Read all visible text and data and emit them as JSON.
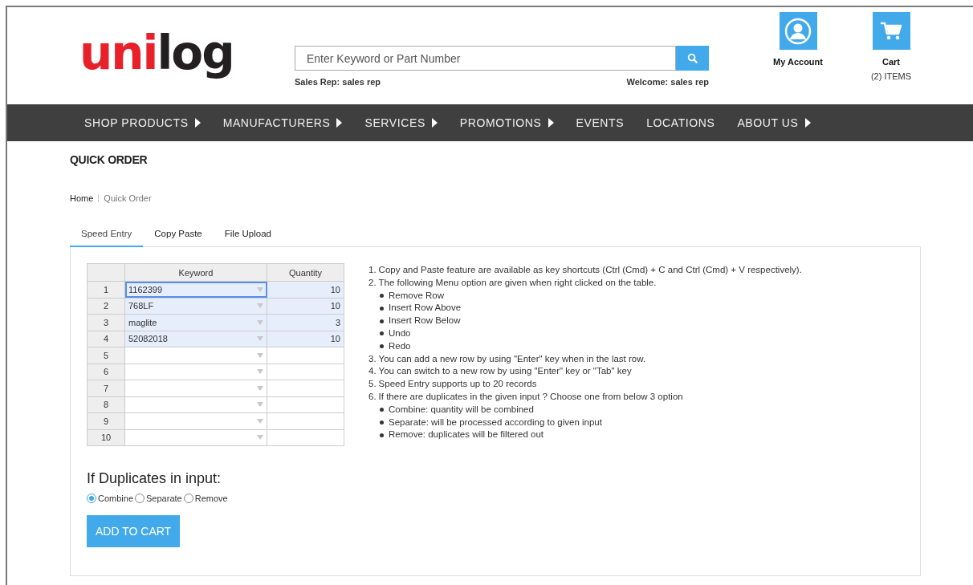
{
  "header": {
    "logo": {
      "red": "uni",
      "dark": "log"
    },
    "search": {
      "placeholder": "Enter Keyword or Part Number"
    },
    "sales_rep": "Sales Rep: sales rep",
    "welcome": "Welcome: sales rep",
    "account": {
      "label": "My Account"
    },
    "cart": {
      "label": "Cart",
      "count": "(2) ITEMS"
    }
  },
  "nav": [
    {
      "label": "SHOP PRODUCTS",
      "has_submenu": true
    },
    {
      "label": "MANUFACTURERS",
      "has_submenu": true
    },
    {
      "label": "SERVICES",
      "has_submenu": true
    },
    {
      "label": "PROMOTIONS",
      "has_submenu": true
    },
    {
      "label": "EVENTS",
      "has_submenu": false
    },
    {
      "label": "LOCATIONS",
      "has_submenu": false
    },
    {
      "label": "ABOUT US",
      "has_submenu": true
    }
  ],
  "page_title": "QUICK ORDER",
  "breadcrumb": [
    {
      "label": "Home",
      "current": false
    },
    {
      "label": "Quick Order",
      "current": true
    }
  ],
  "tabs": [
    {
      "label": "Speed Entry",
      "selected": true
    },
    {
      "label": "Copy Paste",
      "selected": false
    },
    {
      "label": "File Upload",
      "selected": false
    }
  ],
  "table": {
    "columns": [
      "Keyword",
      "Quantity"
    ],
    "rows": [
      {
        "index": "1",
        "keyword": "1162399",
        "quantity": "10",
        "selected": true,
        "focused": true
      },
      {
        "index": "2",
        "keyword": "768LF",
        "quantity": "10",
        "selected": true,
        "focused": false
      },
      {
        "index": "3",
        "keyword": "maglite",
        "quantity": "3",
        "selected": true,
        "focused": false
      },
      {
        "index": "4",
        "keyword": "52082018",
        "quantity": "10",
        "selected": true,
        "focused": false
      },
      {
        "index": "5",
        "selected": false,
        "focused": false
      },
      {
        "index": "6",
        "selected": false,
        "focused": false
      },
      {
        "index": "7",
        "selected": false,
        "focused": false
      },
      {
        "index": "8",
        "selected": false,
        "focused": false
      },
      {
        "index": "9",
        "selected": false,
        "focused": false
      },
      {
        "index": "10",
        "selected": false,
        "focused": false
      }
    ]
  },
  "instructions": [
    {
      "number": "1.",
      "text": "Copy and Paste feature are available as key shortcuts (Ctrl (Cmd) + C and Ctrl (Cmd) + V respectively)."
    },
    {
      "number": "2.",
      "text": "The following Menu option are given when right clicked on the table.",
      "children": [
        "Remove Row",
        "Insert Row Above",
        "Insert Row Below",
        "Undo",
        "Redo"
      ]
    },
    {
      "number": "3.",
      "text": "You can add a new row by using \"Enter\" key when in the last row."
    },
    {
      "number": "4.",
      "text": "You can switch to a new row by using \"Enter\" key or \"Tab\" key"
    },
    {
      "number": "5.",
      "text": "Speed Entry supports up to 20 records"
    },
    {
      "number": "6.",
      "text": "If there are duplicates in the given input ? Choose one from below 3 option",
      "children": [
        "Combine: quantity will be combined",
        "Separate: will be processed according to given input",
        "Remove: duplicates will be filtered out"
      ]
    }
  ],
  "duplicates": {
    "heading": "If Duplicates in input:",
    "options": [
      {
        "label": "Combine",
        "selected": true
      },
      {
        "label": "Separate",
        "selected": false
      },
      {
        "label": "Remove",
        "selected": false
      }
    ]
  },
  "add_to_cart": "ADD TO CART"
}
